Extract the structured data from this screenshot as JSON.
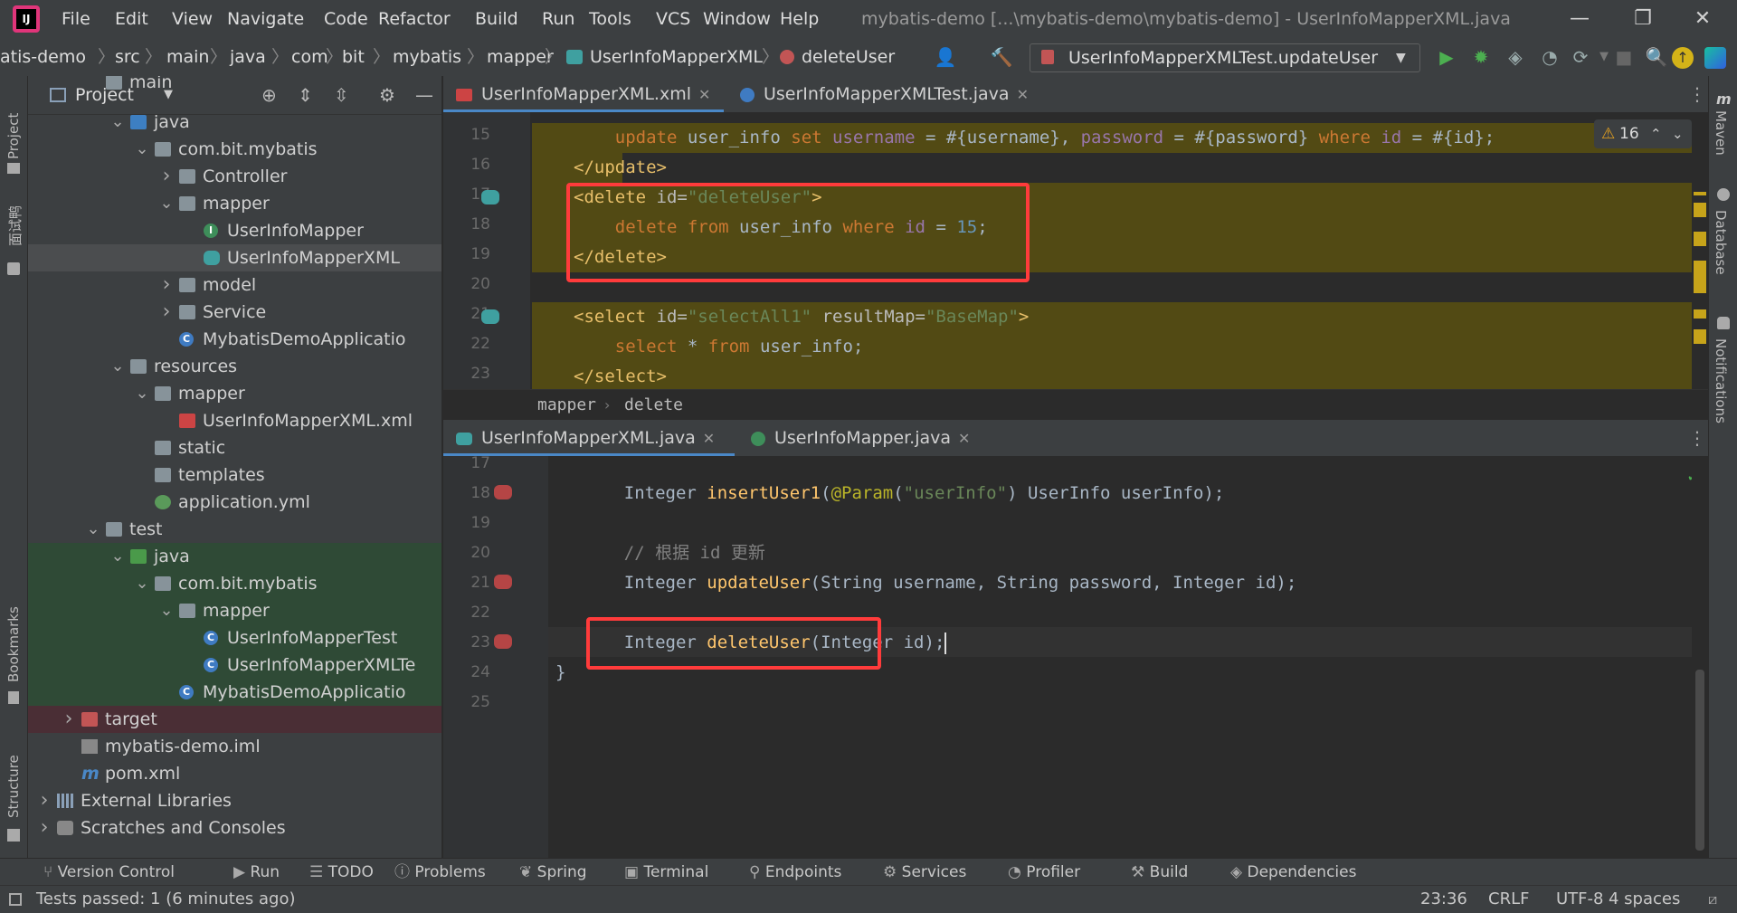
{
  "titlebar": {
    "menus": [
      "File",
      "Edit",
      "View",
      "Navigate",
      "Code",
      "Refactor",
      "Build",
      "Run",
      "Tools",
      "VCS",
      "Window",
      "Help"
    ],
    "window_title": "mybatis-demo [...\\mybatis-demo\\mybatis-demo] - UserInfoMapperXML.java",
    "min": "—",
    "max": "❐",
    "close": "✕"
  },
  "navbar": {
    "crumbs": [
      "atis-demo",
      "src",
      "main",
      "java",
      "com",
      "bit",
      "mybatis",
      "mapper",
      "UserInfoMapperXML",
      "deleteUser"
    ],
    "run_config": "UserInfoMapperXMLTest.updateUser"
  },
  "left_strip": {
    "project": "Project",
    "cn": "面试鸭",
    "bookmarks": "Bookmarks",
    "structure": "Structure"
  },
  "right_strip": {
    "maven": "Maven",
    "database": "Database",
    "notifications": "Notifications"
  },
  "project": {
    "title": "Project",
    "tree": [
      {
        "label": "main",
        "indent": 2,
        "arrow": "",
        "icon": "folder",
        "cut": true
      },
      {
        "label": "java",
        "indent": 3,
        "arrow": "v",
        "icon": "folder-blue"
      },
      {
        "label": "com.bit.mybatis",
        "indent": 4,
        "arrow": "v",
        "icon": "folder"
      },
      {
        "label": "Controller",
        "indent": 5,
        "arrow": ">",
        "icon": "folder"
      },
      {
        "label": "mapper",
        "indent": 5,
        "arrow": "v",
        "icon": "folder"
      },
      {
        "label": "UserInfoMapper",
        "indent": 6,
        "arrow": "",
        "icon": "cls-i"
      },
      {
        "label": "UserInfoMapperXML",
        "indent": 6,
        "arrow": "",
        "icon": "bird",
        "selected": true
      },
      {
        "label": "model",
        "indent": 5,
        "arrow": ">",
        "icon": "folder"
      },
      {
        "label": "Service",
        "indent": 5,
        "arrow": ">",
        "icon": "folder"
      },
      {
        "label": "MybatisDemoApplicatio",
        "indent": 5,
        "arrow": "",
        "icon": "cls-c"
      },
      {
        "label": "resources",
        "indent": 3,
        "arrow": "v",
        "icon": "folder"
      },
      {
        "label": "mapper",
        "indent": 4,
        "arrow": "v",
        "icon": "folder"
      },
      {
        "label": "UserInfoMapperXML.xml",
        "indent": 5,
        "arrow": "",
        "icon": "xml"
      },
      {
        "label": "static",
        "indent": 4,
        "arrow": "",
        "icon": "folder"
      },
      {
        "label": "templates",
        "indent": 4,
        "arrow": "",
        "icon": "folder"
      },
      {
        "label": "application.yml",
        "indent": 4,
        "arrow": "",
        "icon": "yml"
      },
      {
        "label": "test",
        "indent": 2,
        "arrow": "v",
        "icon": "folder"
      },
      {
        "label": "java",
        "indent": 3,
        "arrow": "v",
        "icon": "folder-green",
        "test": true
      },
      {
        "label": "com.bit.mybatis",
        "indent": 4,
        "arrow": "v",
        "icon": "folder",
        "test": true
      },
      {
        "label": "mapper",
        "indent": 5,
        "arrow": "v",
        "icon": "folder",
        "test": true
      },
      {
        "label": "UserInfoMapperTest",
        "indent": 6,
        "arrow": "",
        "icon": "cls-c",
        "test": true
      },
      {
        "label": "UserInfoMapperXMLTe",
        "indent": 6,
        "arrow": "",
        "icon": "cls-c",
        "test": true
      },
      {
        "label": "MybatisDemoApplicatio",
        "indent": 5,
        "arrow": "",
        "icon": "cls-c",
        "test": true
      },
      {
        "label": "target",
        "indent": 1,
        "arrow": ">",
        "icon": "folder-red",
        "excluded": true
      },
      {
        "label": "mybatis-demo.iml",
        "indent": 1,
        "arrow": "",
        "icon": "iml"
      },
      {
        "label": "pom.xml",
        "indent": 1,
        "arrow": "",
        "icon": "pom"
      },
      {
        "label": "External Libraries",
        "indent": 0,
        "arrow": ">",
        "icon": "lib"
      },
      {
        "label": "Scratches and Consoles",
        "indent": 0,
        "arrow": ">",
        "icon": "scratch"
      }
    ]
  },
  "top_editor": {
    "tabs": [
      {
        "label": "UserInfoMapperXML.xml",
        "active": true
      },
      {
        "label": "UserInfoMapperXMLTest.java",
        "active": false
      }
    ],
    "warnings": "16",
    "breadcrumb": [
      "mapper",
      "delete"
    ],
    "line_numbers": [
      "15",
      "16",
      "17",
      "18",
      "19",
      "20",
      "21",
      "22",
      "23"
    ]
  },
  "bottom_editor": {
    "tabs": [
      {
        "label": "UserInfoMapperXML.java",
        "active": true
      },
      {
        "label": "UserInfoMapper.java",
        "active": false
      }
    ],
    "line_numbers": [
      "17",
      "18",
      "19",
      "20",
      "21",
      "22",
      "23",
      "24",
      "25"
    ]
  },
  "bottom_tools": [
    "Version Control",
    "Run",
    "TODO",
    "Problems",
    "Spring",
    "Terminal",
    "Endpoints",
    "Services",
    "Profiler",
    "Build",
    "Dependencies"
  ],
  "status": {
    "message": "Tests passed: 1 (6 minutes ago)",
    "position": "23:36",
    "line_sep": "CRLF",
    "encoding": "UTF-8",
    "indent": "4 spaces"
  }
}
